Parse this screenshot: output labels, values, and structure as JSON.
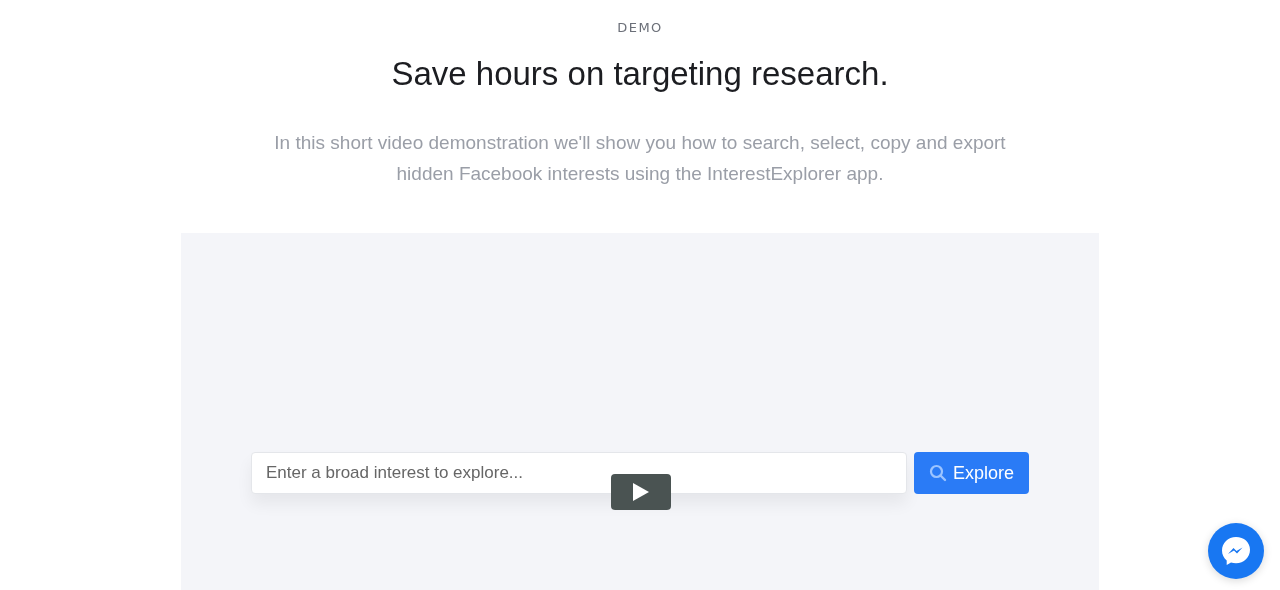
{
  "eyebrow": "DEMO",
  "heading": "Save hours on targeting research.",
  "intro": "In this short video demonstration we'll show you how to search, select, copy and export hidden Facebook interests using the InterestExplorer app.",
  "video": {
    "search": {
      "placeholder": "Enter a broad interest to explore..."
    },
    "button": "Explore"
  }
}
